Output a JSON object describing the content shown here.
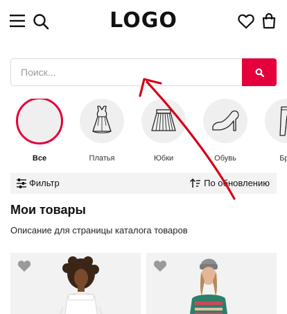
{
  "header": {
    "logo": "LOGO",
    "icons": [
      "menu-icon",
      "search-icon",
      "heart-icon",
      "bag-icon"
    ]
  },
  "search": {
    "placeholder": "Поиск...",
    "value": "",
    "button_icon": "search-icon"
  },
  "categories": [
    {
      "label": "Все",
      "icon": "all",
      "active": true
    },
    {
      "label": "Платья",
      "icon": "dress-icon",
      "active": false
    },
    {
      "label": "Юбки",
      "icon": "skirt-icon",
      "active": false
    },
    {
      "label": "Обувь",
      "icon": "shoe-icon",
      "active": false
    },
    {
      "label": "Брю",
      "icon": "trousers-icon",
      "active": false
    }
  ],
  "filter": {
    "filter_label": "Фильтр",
    "sort_label": "По обновлению"
  },
  "page": {
    "title": "Мои товары",
    "description": "Описание для страницы каталога товаров"
  },
  "colors": {
    "accent": "#e4003b",
    "arrow": "#d50018",
    "filter_bg": "#f3f3f3",
    "circle_bg": "#efefef"
  }
}
